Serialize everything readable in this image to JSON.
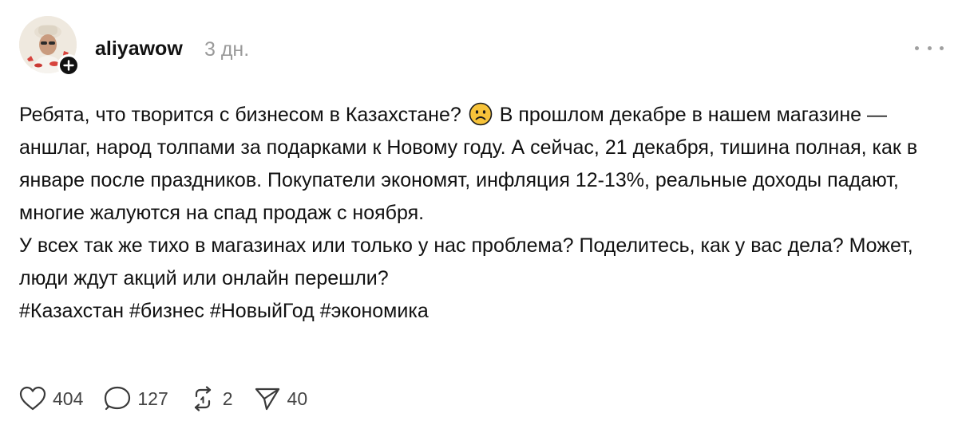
{
  "post": {
    "author": {
      "username": "aliyawow",
      "timestamp": "3 дн."
    },
    "text": {
      "paragraph1_before_emoji": "Ребята, что творится с бизнесом в Казахстане?",
      "paragraph1_after_emoji": "В прошлом декабре в нашем магазине — аншлаг, народ толпами за подарками к Новому году. А сейчас, 21 декабря, тишина полная, как в январе после праздников. Покупатели экономят, инфляция 12-13%, реальные доходы падают, многие жалуются на спад продаж с ноября.",
      "paragraph2": "У всех так же тихо в магазинах или только у нас проблема? Поделитесь, как у вас дела? Может, люди ждут акций или онлайн перешли?",
      "hashtags": [
        "#Казахстан",
        "#бизнес",
        "#НовыйГод",
        "#экономика"
      ]
    },
    "emoji": "worried-face-icon",
    "actions": {
      "likes": "404",
      "comments": "127",
      "reposts": "2",
      "shares": "40"
    }
  },
  "icons": {
    "more": "more-dots-icon",
    "follow": "plus-icon",
    "like": "heart-icon",
    "comment": "comment-bubble-icon",
    "repost": "repost-icon",
    "share": "send-icon"
  },
  "colors": {
    "text": "#111111",
    "muted": "#9a9a9a",
    "count": "#444444",
    "emoji_face": "#f7c33a"
  }
}
